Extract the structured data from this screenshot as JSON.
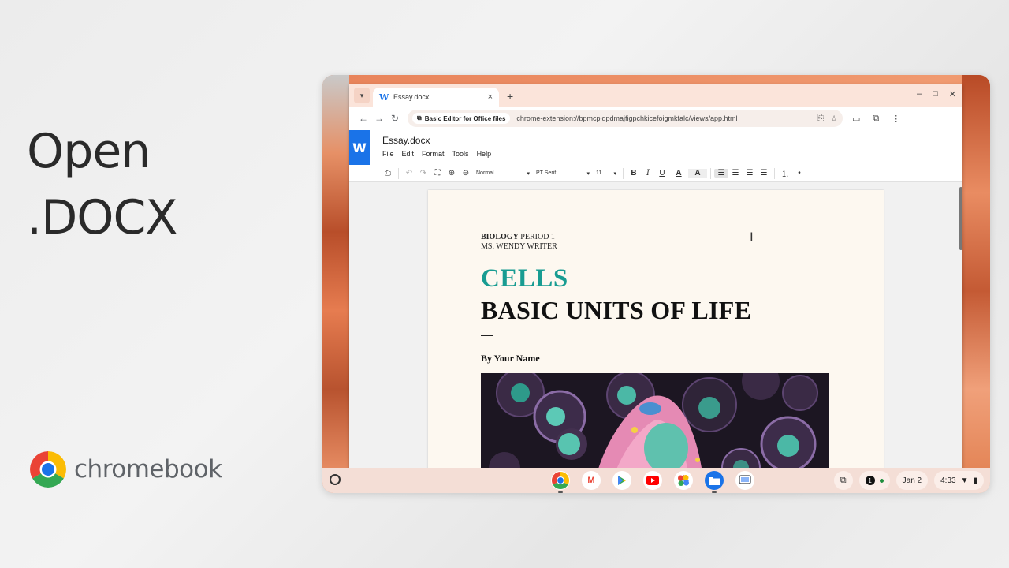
{
  "promo": {
    "headline_line1": "Open",
    "headline_line2": ".DOCX",
    "brand_name": "chromebook"
  },
  "browser": {
    "tab": {
      "title": "Essay.docx",
      "close": "×"
    },
    "new_tab": "+",
    "window_controls": {
      "minimize": "–",
      "maximize": "□",
      "close": "✕"
    },
    "omnibox": {
      "extension_chip": "Basic Editor for Office files",
      "url": "chrome-extension://bpmcpldpdmajfigpchkicefoigmkfalc/views/app.html"
    }
  },
  "app": {
    "logo_letter": "W",
    "document_name": "Essay.docx",
    "menu": [
      "File",
      "Edit",
      "Format",
      "Tools",
      "Help"
    ],
    "format_bar": {
      "style": "Normal",
      "font": "PT Serif",
      "size": "11",
      "bold": "B",
      "italic": "I",
      "underline": "U",
      "text_color": "A",
      "highlight": "A"
    }
  },
  "document": {
    "header_bold": "BIOLOGY",
    "header_rest": " PERIOD 1",
    "header_line2": "MS. WENDY WRITER",
    "title": "CELLS",
    "subtitle": "BASIC UNITS OF LIFE",
    "byline": "By Your Name",
    "colors": {
      "title_teal": "#189c92"
    }
  },
  "shelf": {
    "apps": [
      {
        "name": "chrome-app-icon"
      },
      {
        "name": "gmail-app-icon"
      },
      {
        "name": "play-store-app-icon"
      },
      {
        "name": "youtube-app-icon"
      },
      {
        "name": "photos-app-icon"
      },
      {
        "name": "files-app-icon"
      },
      {
        "name": "screenshot-app-icon"
      }
    ],
    "notification_count": "1",
    "date": "Jan 2",
    "time": "4:33"
  }
}
